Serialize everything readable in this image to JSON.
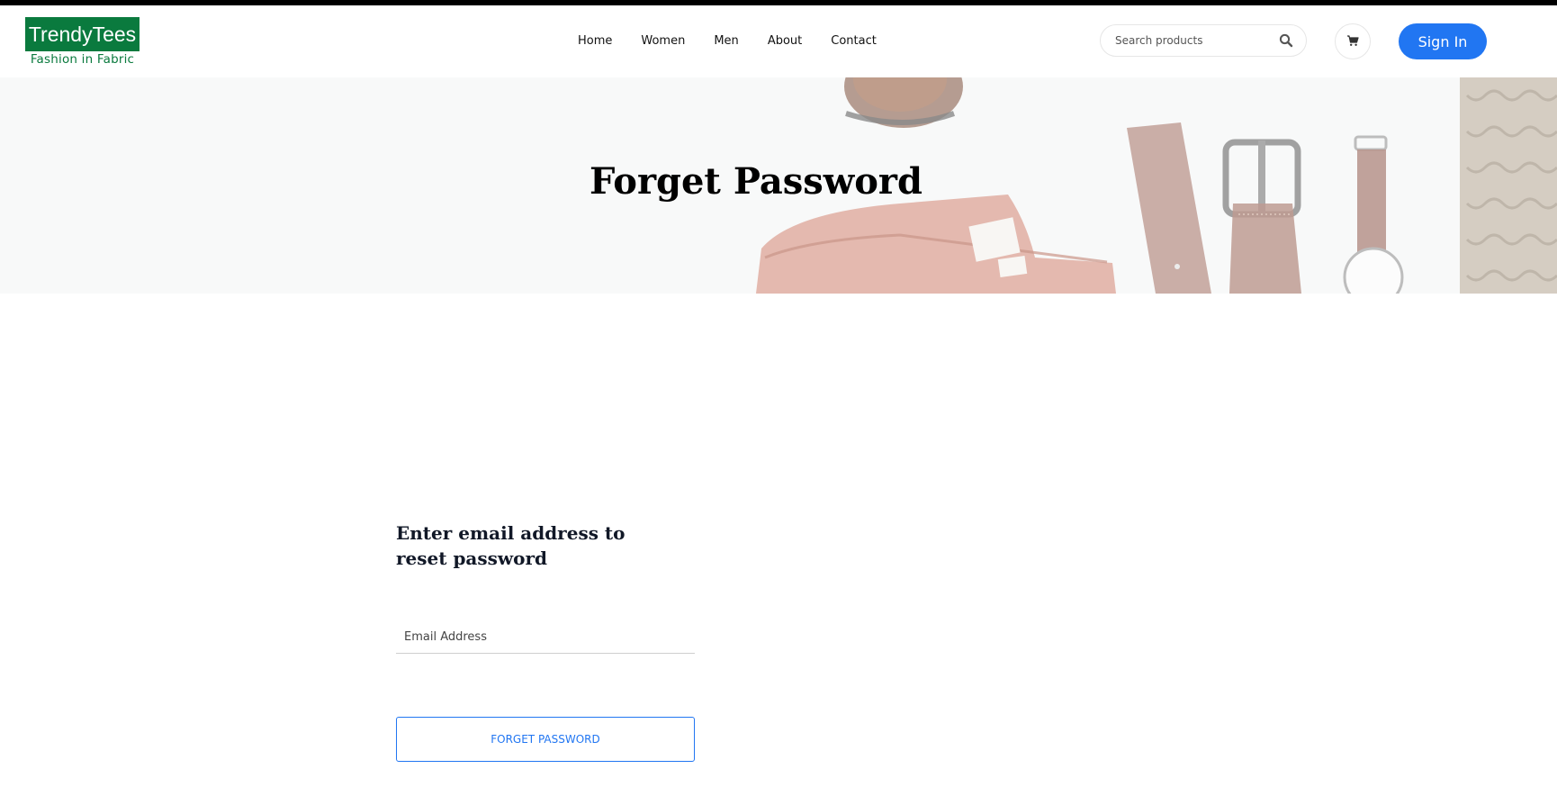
{
  "brand": {
    "name": "TrendyTees",
    "tagline": "Fashion in Fabric",
    "color": "#0a7a3e"
  },
  "nav": {
    "items": [
      "Home",
      "Women",
      "Men",
      "About",
      "Contact"
    ]
  },
  "search": {
    "placeholder": "Search products",
    "icon": "search-icon"
  },
  "cart": {
    "icon": "cart-icon"
  },
  "signin": {
    "label": "Sign In",
    "color": "#2176f2"
  },
  "hero": {
    "title": "Forget Password"
  },
  "form": {
    "heading": "Enter email address to reset password",
    "email_placeholder": "Email Address",
    "submit_label": "FORGET PASSWORD"
  }
}
